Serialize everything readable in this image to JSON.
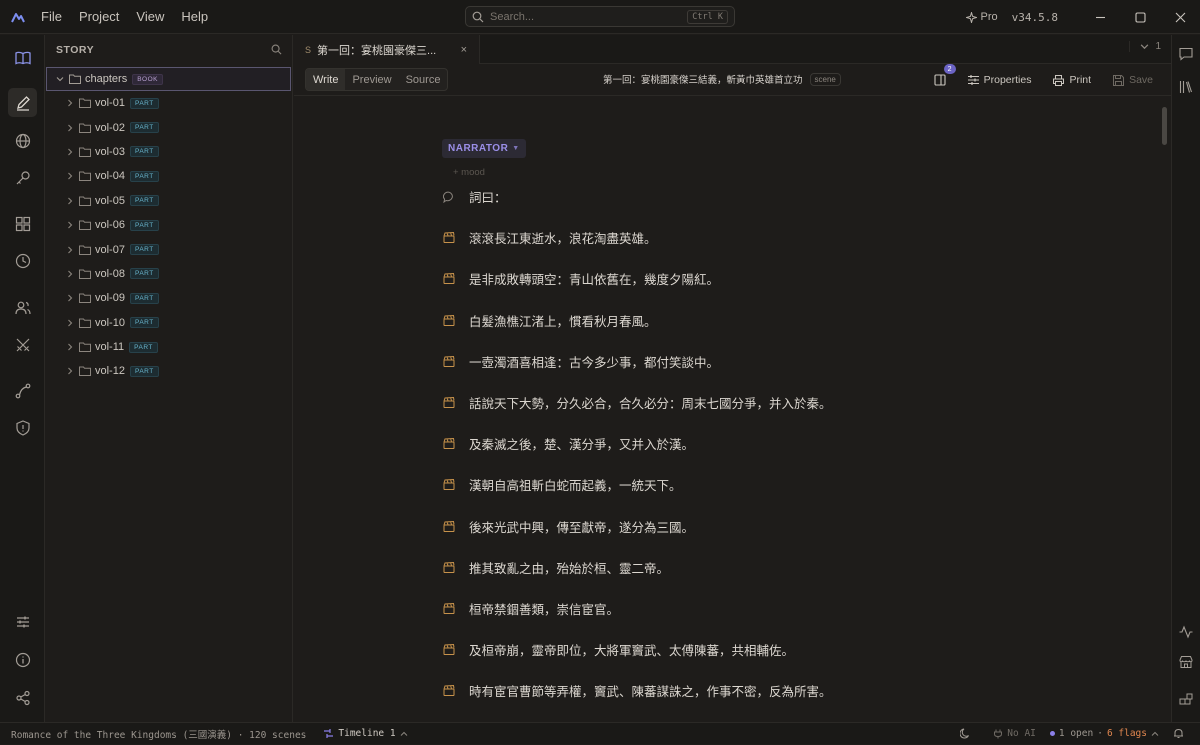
{
  "app": {
    "menu": [
      "File",
      "Project",
      "View",
      "Help"
    ],
    "search_placeholder": "Search...",
    "search_shortcut": "Ctrl K",
    "pro_label": "Pro",
    "version": "v34.5.8"
  },
  "sidebar": {
    "title": "STORY",
    "root": {
      "label": "chapters",
      "badge": "BOOK"
    },
    "items": [
      {
        "label": "vol-01",
        "badge": "PART"
      },
      {
        "label": "vol-02",
        "badge": "PART"
      },
      {
        "label": "vol-03",
        "badge": "PART"
      },
      {
        "label": "vol-04",
        "badge": "PART"
      },
      {
        "label": "vol-05",
        "badge": "PART"
      },
      {
        "label": "vol-06",
        "badge": "PART"
      },
      {
        "label": "vol-07",
        "badge": "PART"
      },
      {
        "label": "vol-08",
        "badge": "PART"
      },
      {
        "label": "vol-09",
        "badge": "PART"
      },
      {
        "label": "vol-10",
        "badge": "PART"
      },
      {
        "label": "vol-11",
        "badge": "PART"
      },
      {
        "label": "vol-12",
        "badge": "PART"
      }
    ]
  },
  "editor": {
    "tab": {
      "prefix": "S",
      "label": "第一回：宴桃園豪傑三...",
      "close": "×"
    },
    "tab_count": "1",
    "modes": [
      "Write",
      "Preview",
      "Source"
    ],
    "doc_title": "第一回：宴桃園豪傑三結義，斬黃巾英雄首立功",
    "doc_type": "scene",
    "split_count": "2",
    "properties_label": "Properties",
    "print_label": "Print",
    "save_label": "Save",
    "speaker": "NARRATOR",
    "mood_placeholder": "+ mood",
    "lines": [
      {
        "icon": "speech-icon",
        "text": "詞曰："
      },
      {
        "icon": "clapper-icon",
        "text": "滾滾長江東逝水，浪花淘盡英雄。"
      },
      {
        "icon": "clapper-icon",
        "text": "是非成敗轉頭空：青山依舊在，幾度夕陽紅。"
      },
      {
        "icon": "clapper-icon",
        "text": "白髮漁樵江渚上，慣看秋月春風。"
      },
      {
        "icon": "clapper-icon",
        "text": "一壺濁酒喜相逢：古今多少事，都付笑談中。"
      },
      {
        "icon": "clapper-icon",
        "text": "話說天下大勢，分久必合，合久必分：周末七國分爭，并入於秦。"
      },
      {
        "icon": "clapper-icon",
        "text": "及秦滅之後，楚、漢分爭，又并入於漢。"
      },
      {
        "icon": "clapper-icon",
        "text": "漢朝自高祖斬白蛇而起義，一統天下。"
      },
      {
        "icon": "clapper-icon",
        "text": "後來光武中興，傳至獻帝，遂分為三國。"
      },
      {
        "icon": "clapper-icon",
        "text": "推其致亂之由，殆始於桓、靈二帝。"
      },
      {
        "icon": "clapper-icon",
        "text": "桓帝禁錮善類，崇信宦官。"
      },
      {
        "icon": "clapper-icon",
        "text": "及桓帝崩，靈帝即位，大將軍竇武、太傅陳蕃，共相輔佐。"
      },
      {
        "icon": "clapper-icon",
        "text": "時有宦官曹節等弄權，竇武、陳蕃謀誅之，作事不密，反為所害。"
      }
    ]
  },
  "status": {
    "project": "Romance of the Three Kingdoms (三國演義) · 120 scenes",
    "timeline": "Timeline 1",
    "ai": "No AI",
    "open": "1 open",
    "sep": "·",
    "flags": "6 flags"
  },
  "colors": {
    "accent": "#8b7fe8",
    "flags": "#e0864f",
    "part_badge": "#68b4cc",
    "book_badge": "#b8a0d0"
  }
}
